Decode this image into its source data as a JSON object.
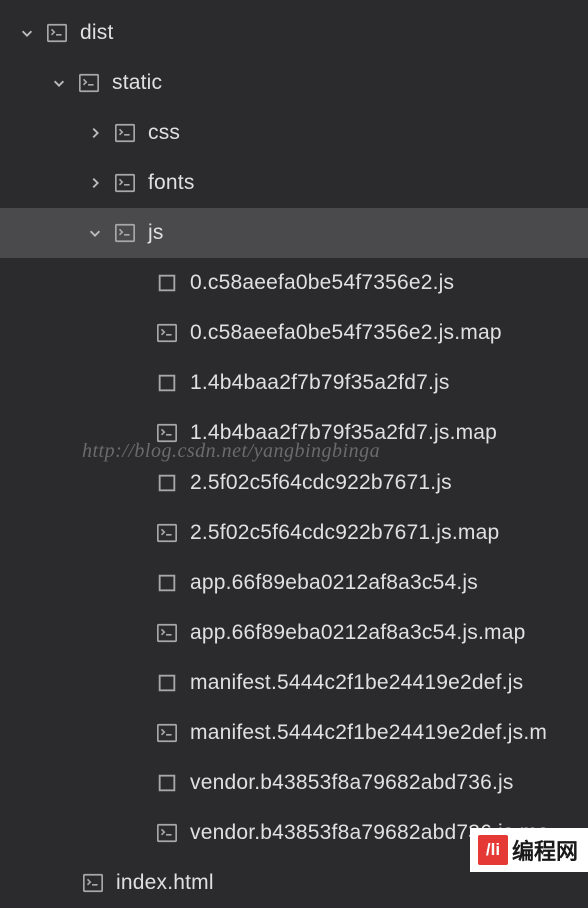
{
  "tree": {
    "root": {
      "label": "dist",
      "expanded": true,
      "icon": "terminal",
      "indent": 0
    },
    "children": [
      {
        "label": "static",
        "expanded": true,
        "icon": "terminal",
        "indent": 1,
        "type": "folder"
      },
      {
        "label": "css",
        "expanded": false,
        "icon": "terminal",
        "indent": 2,
        "type": "folder"
      },
      {
        "label": "fonts",
        "expanded": false,
        "icon": "terminal",
        "indent": 2,
        "type": "folder"
      },
      {
        "label": "js",
        "expanded": true,
        "icon": "terminal",
        "indent": 2,
        "type": "folder",
        "selected": true
      },
      {
        "label": "0.c58aeefa0be54f7356e2.js",
        "icon": "square",
        "indent": 3,
        "type": "file"
      },
      {
        "label": "0.c58aeefa0be54f7356e2.js.map",
        "icon": "terminal",
        "indent": 3,
        "type": "file"
      },
      {
        "label": "1.4b4baa2f7b79f35a2fd7.js",
        "icon": "square",
        "indent": 3,
        "type": "file"
      },
      {
        "label": "1.4b4baa2f7b79f35a2fd7.js.map",
        "icon": "terminal",
        "indent": 3,
        "type": "file"
      },
      {
        "label": "2.5f02c5f64cdc922b7671.js",
        "icon": "square",
        "indent": 3,
        "type": "file"
      },
      {
        "label": "2.5f02c5f64cdc922b7671.js.map",
        "icon": "terminal",
        "indent": 3,
        "type": "file"
      },
      {
        "label": "app.66f89eba0212af8a3c54.js",
        "icon": "square",
        "indent": 3,
        "type": "file"
      },
      {
        "label": "app.66f89eba0212af8a3c54.js.map",
        "icon": "terminal",
        "indent": 3,
        "type": "file"
      },
      {
        "label": "manifest.5444c2f1be24419e2def.js",
        "icon": "square",
        "indent": 3,
        "type": "file"
      },
      {
        "label": "manifest.5444c2f1be24419e2def.js.m",
        "icon": "terminal",
        "indent": 3,
        "type": "file"
      },
      {
        "label": "vendor.b43853f8a79682abd736.js",
        "icon": "square",
        "indent": 3,
        "type": "file"
      },
      {
        "label": "vendor.b43853f8a79682abd736.js.ma",
        "icon": "terminal",
        "indent": 3,
        "type": "file"
      },
      {
        "label": "index.html",
        "icon": "terminal",
        "indent": "root-file",
        "type": "file"
      }
    ]
  },
  "watermark": "http://blog.csdn.net/yangbingbinga",
  "badge": {
    "icon": "/li",
    "text": "编程网"
  }
}
